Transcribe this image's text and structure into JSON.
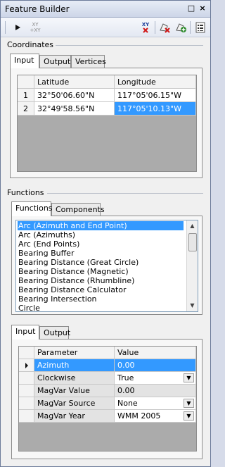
{
  "window": {
    "title": "Feature Builder"
  },
  "title_buttons": {
    "pin": "□",
    "close": "×"
  },
  "toolbar": {
    "xy_label_top": "XY",
    "xy_label_bottom": "+XY",
    "xy_red_label": "XY"
  },
  "coordinates": {
    "group_label": "Coordinates",
    "tabs": [
      "Input",
      "Output",
      "Vertices"
    ],
    "active_tab": "Input",
    "columns": [
      "Latitude",
      "Longitude"
    ],
    "rows": [
      {
        "num": "1",
        "latitude": "32°50'06.60\"N",
        "longitude": "117°05'06.15\"W"
      },
      {
        "num": "2",
        "latitude": "32°49'58.56\"N",
        "longitude": "117°05'10.13\"W"
      }
    ]
  },
  "functions": {
    "group_label": "Functions",
    "tabs": [
      "Functions",
      "Components"
    ],
    "active_tab": "Functions",
    "items": [
      "Arc (Azimuth and End Point)",
      "Arc (Azimuths)",
      "Arc (End Points)",
      "Bearing Buffer",
      "Bearing Distance (Great Circle)",
      "Bearing Distance (Magnetic)",
      "Bearing Distance (Rhumbline)",
      "Bearing Distance Calculator",
      "Bearing Intersection",
      "Circle"
    ],
    "selected_index": 0
  },
  "parameters": {
    "tabs": [
      "Input",
      "Output"
    ],
    "active_tab": "Input",
    "columns": [
      "Parameter",
      "Value"
    ],
    "rows": [
      {
        "name": "Azimuth",
        "value": "0.00",
        "dropdown": false
      },
      {
        "name": "Clockwise",
        "value": "True",
        "dropdown": true
      },
      {
        "name": "MagVar Value",
        "value": "0.00",
        "dropdown": false
      },
      {
        "name": "MagVar Source",
        "value": "None",
        "dropdown": true
      },
      {
        "name": "MagVar Year",
        "value": "WMM 2005",
        "dropdown": true
      }
    ]
  }
}
